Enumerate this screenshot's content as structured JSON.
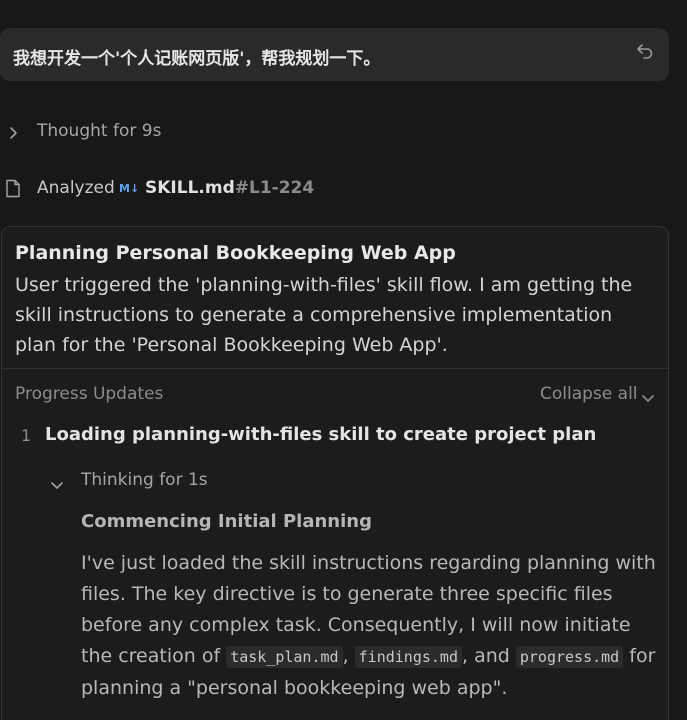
{
  "user_message": {
    "text": "我想开发一个'个人记账网页版'，帮我规划一下。"
  },
  "thought": {
    "label": "Thought for 9s"
  },
  "analyzed": {
    "label": "Analyzed",
    "md_icon": "M↓",
    "file_name": "SKILL.md",
    "range": "#L1-224"
  },
  "task": {
    "title": "Planning Personal Bookkeeping Web App",
    "description": "User triggered the 'planning-with-files' skill flow. I am getting the skill instructions to generate a comprehensive implementation plan for the 'Personal Bookkeeping Web App'.",
    "progress_label": "Progress Updates",
    "collapse_label": "Collapse all",
    "steps": [
      {
        "number": "1",
        "title": "Loading planning-with-files skill to create project plan",
        "thinking_label": "Thinking for 1s",
        "heading": "Commencing Initial Planning",
        "body_part1": "I've just loaded the skill instructions regarding planning with files. The key directive is to generate three specific files before any complex task. Consequently, I will now initiate the creation of ",
        "code1": "task_plan.md",
        "sep1": ", ",
        "code2": "findings.md",
        "sep2": ", and ",
        "code3": "progress.md",
        "body_part2": " for planning a \"personal bookkeeping web app\"."
      }
    ]
  },
  "colors": {
    "background": "#181818",
    "card": "#2a2a2a",
    "md_icon": "#5da3f0",
    "muted_text": "#8c8c8c"
  }
}
